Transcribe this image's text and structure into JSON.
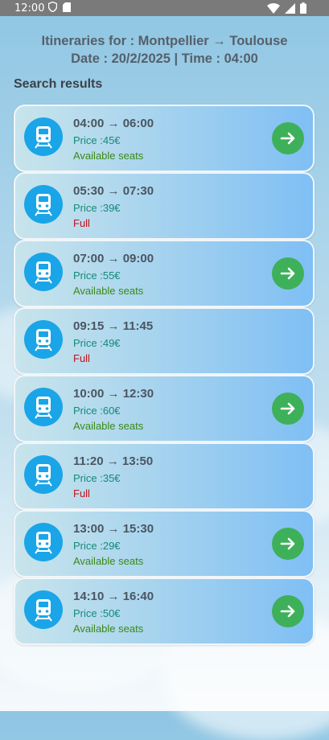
{
  "status_bar": {
    "time": "12:00"
  },
  "header": {
    "line1": "Itineraries for : Montpellier → Toulouse",
    "line2": "Date : 20/2/2025 | Time : 04:00"
  },
  "section_title": "Search results",
  "colors": {
    "available": "#3a8a16",
    "full": "#c0121a",
    "go_button": "#3eb05a",
    "train_badge": "#1aa5e8"
  },
  "results": [
    {
      "times": "04:00 → 06:00",
      "price": "Price :45€",
      "status": "Available seats",
      "available": true
    },
    {
      "times": "05:30 → 07:30",
      "price": "Price :39€",
      "status": "Full",
      "available": false
    },
    {
      "times": "07:00 → 09:00",
      "price": "Price :55€",
      "status": "Available seats",
      "available": true
    },
    {
      "times": "09:15 → 11:45",
      "price": "Price :49€",
      "status": "Full",
      "available": false
    },
    {
      "times": "10:00 → 12:30",
      "price": "Price :60€",
      "status": "Available seats",
      "available": true
    },
    {
      "times": "11:20 → 13:50",
      "price": "Price :35€",
      "status": "Full",
      "available": false
    },
    {
      "times": "13:00 → 15:30",
      "price": "Price :29€",
      "status": "Available seats",
      "available": true
    },
    {
      "times": "14:10 → 16:40",
      "price": "Price :50€",
      "status": "Available seats",
      "available": true
    }
  ]
}
